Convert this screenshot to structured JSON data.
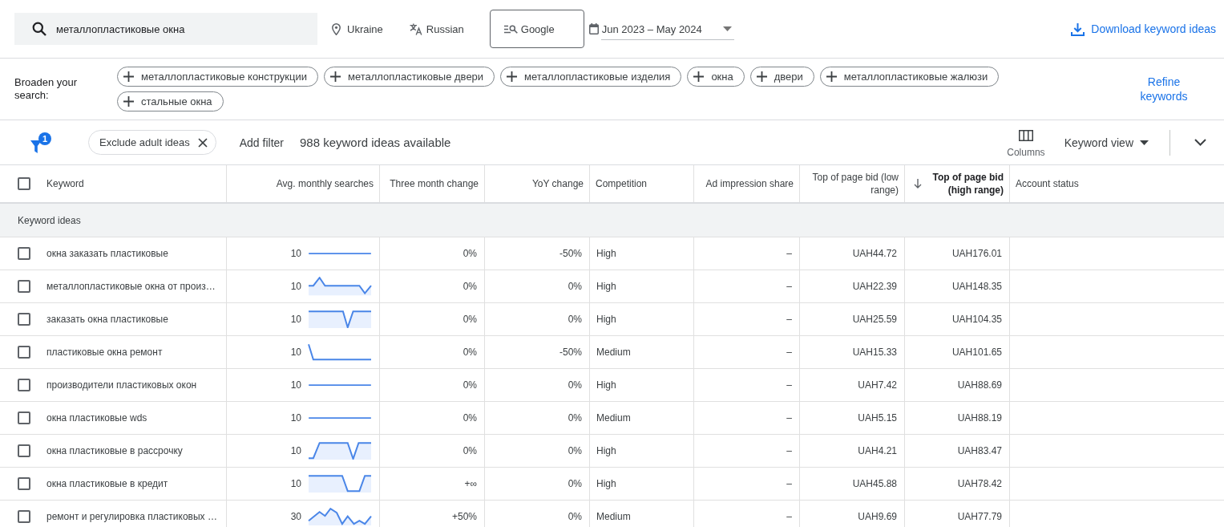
{
  "search": {
    "value": "металлопластиковые окна"
  },
  "toolbar": {
    "location": "Ukraine",
    "language": "Russian",
    "network": "Google",
    "date_range": "Jun 2023 – May 2024",
    "download_link": "Download keyword ideas"
  },
  "broaden": {
    "label": "Broaden your search:",
    "chips": [
      "металлопластиковые конструкции",
      "металлопластиковые двери",
      "металлопластиковые изделия",
      "окна",
      "двери",
      "металлопластиковые жалюзи",
      "стальные окна"
    ],
    "refine_link": "Refine keywords"
  },
  "filter_bar": {
    "filter_count": "1",
    "active_filters": [
      "Exclude adult ideas"
    ],
    "add_filter": "Add filter",
    "summary": "988 keyword ideas available",
    "columns_button": "Columns",
    "view_menu": "Keyword view"
  },
  "table": {
    "select_all_checked": false,
    "columns": [
      {
        "label": "Keyword",
        "kind": "text",
        "sorted": false
      },
      {
        "label": "Avg. monthly searches",
        "kind": "trend",
        "sorted": false
      },
      {
        "label": "Three month change",
        "kind": "number",
        "sorted": false
      },
      {
        "label": "YoY change",
        "kind": "number",
        "sorted": false
      },
      {
        "label": "Competition",
        "kind": "text",
        "sorted": false
      },
      {
        "label": "Ad impression share",
        "kind": "number",
        "sorted": false
      },
      {
        "label": "Top of page bid (low range)",
        "kind": "number",
        "sorted": false
      },
      {
        "label": "Top of page bid (high range)",
        "kind": "number",
        "sorted": true
      },
      {
        "label": "Account status",
        "kind": "text",
        "sorted": false
      }
    ],
    "group_label": "Keyword ideas",
    "rows": [
      {
        "checked": false,
        "cells": [
          "окна заказать пластиковые",
          "10",
          "0%",
          "-50%",
          "High",
          "–",
          "UAH44.72",
          "UAH176.01"
        ]
      },
      {
        "checked": false,
        "cells": [
          "металлопластиковые окна от произ…",
          "10",
          "0%",
          "0%",
          "High",
          "–",
          "UAH22.39",
          "UAH148.35"
        ]
      },
      {
        "checked": false,
        "cells": [
          "заказать окна пластиковые",
          "10",
          "0%",
          "0%",
          "High",
          "–",
          "UAH25.59",
          "UAH104.35"
        ]
      },
      {
        "checked": false,
        "cells": [
          "пластиковые окна ремонт",
          "10",
          "0%",
          "-50%",
          "Medium",
          "–",
          "UAH15.33",
          "UAH101.65"
        ]
      },
      {
        "checked": false,
        "cells": [
          "производители пластиковых окон",
          "10",
          "0%",
          "0%",
          "High",
          "–",
          "UAH7.42",
          "UAH88.69"
        ]
      },
      {
        "checked": false,
        "cells": [
          "окна пластиковые wds",
          "10",
          "0%",
          "0%",
          "Medium",
          "–",
          "UAH5.15",
          "UAH88.19"
        ]
      },
      {
        "checked": false,
        "cells": [
          "окна пластиковые в рассрочку",
          "10",
          "0%",
          "0%",
          "High",
          "–",
          "UAH4.21",
          "UAH83.47"
        ]
      },
      {
        "checked": false,
        "cells": [
          "окна пластиковые в кредит",
          "10",
          "+∞",
          "0%",
          "High",
          "–",
          "UAH45.88",
          "UAH78.42"
        ]
      },
      {
        "checked": false,
        "cells": [
          "ремонт и регулировка пластиковых …",
          "30",
          "+50%",
          "0%",
          "Medium",
          "–",
          "UAH9.69",
          "UAH77.79"
        ]
      }
    ]
  }
}
